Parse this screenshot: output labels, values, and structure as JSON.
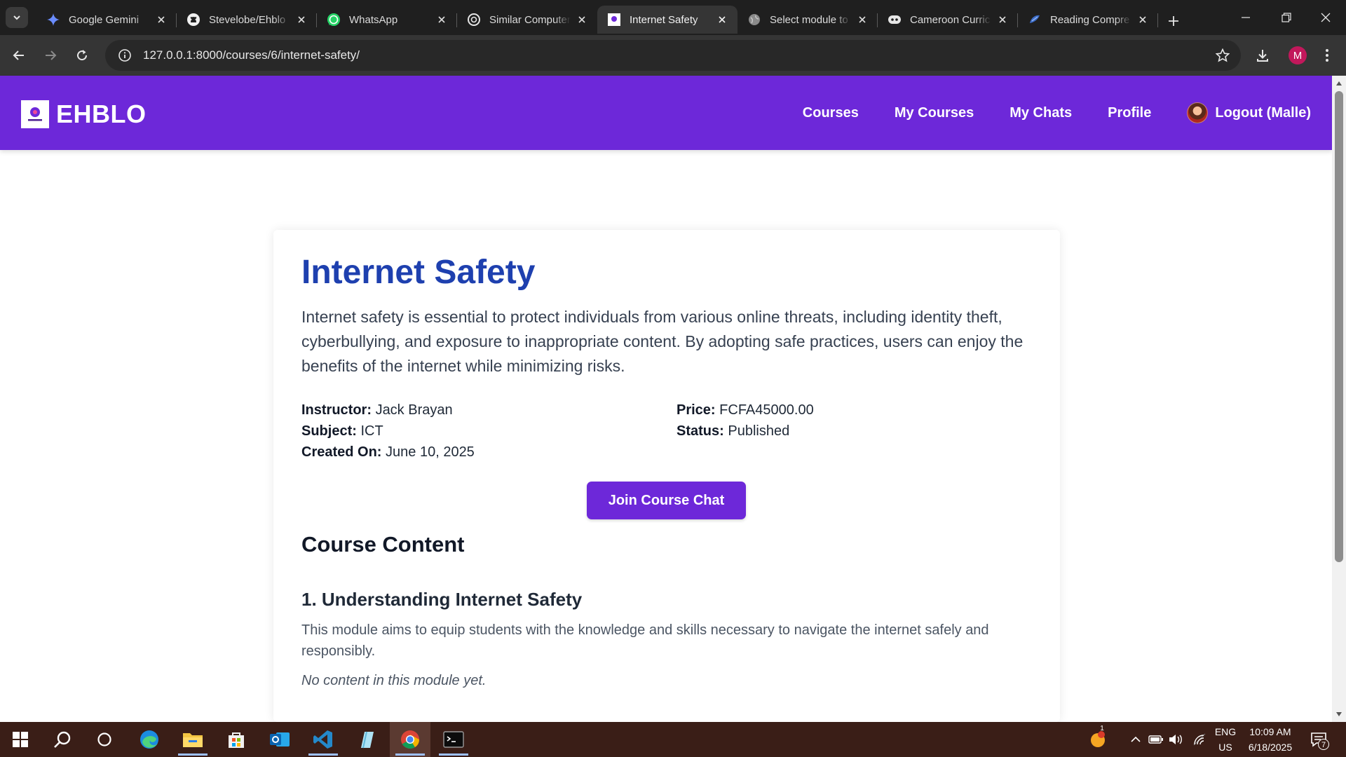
{
  "browser": {
    "tabs": [
      {
        "title": "Google Gemini",
        "icon": "gemini-icon"
      },
      {
        "title": "Stevelobe/Ehblo",
        "icon": "github-icon"
      },
      {
        "title": "WhatsApp",
        "icon": "whatsapp-icon"
      },
      {
        "title": "Similar Computer",
        "icon": "openai-icon"
      },
      {
        "title": "Internet Safety",
        "icon": "ehblo-icon",
        "active": true
      },
      {
        "title": "Select module to",
        "icon": "globe-icon"
      },
      {
        "title": "Cameroon Curric",
        "icon": "discord-icon"
      },
      {
        "title": "Reading Compre",
        "icon": "reading-icon"
      }
    ],
    "url": "127.0.0.1:8000/courses/6/internet-safety/",
    "profile_initial": "M"
  },
  "site": {
    "brand": "EHBLO",
    "brand_logo_text": "EHBLO",
    "nav": {
      "courses": "Courses",
      "my_courses": "My Courses",
      "my_chats": "My Chats",
      "profile": "Profile",
      "logout": "Logout (Malle)"
    },
    "accent_color": "#6d28d9"
  },
  "course": {
    "title": "Internet Safety",
    "description": "Internet safety is essential to protect individuals from various online threats, including identity theft, cyberbullying, and exposure to inappropriate content. By adopting safe practices, users can enjoy the benefits of the internet while minimizing risks.",
    "instructor_label": "Instructor:",
    "instructor": "Jack Brayan",
    "subject_label": "Subject:",
    "subject": "ICT",
    "created_label": "Created On:",
    "created": "June 10, 2025",
    "price_label": "Price:",
    "price": "FCFA45000.00",
    "status_label": "Status:",
    "status": "Published",
    "join_button": "Join Course Chat",
    "content_heading": "Course Content",
    "modules": [
      {
        "title": "1. Understanding Internet Safety",
        "description": "This module aims to equip students with the knowledge and skills necessary to navigate the internet safely and responsibly.",
        "empty_text": "No content in this module yet."
      }
    ]
  },
  "taskbar": {
    "apps": [
      "windows-start-icon",
      "search-icon",
      "task-view-icon",
      "edge-icon",
      "file-explorer-icon",
      "store-icon",
      "outlook-icon",
      "vscode-icon",
      "notepad-icon",
      "chrome-icon",
      "terminal-icon"
    ],
    "weather_badge": "1",
    "language": "ENG",
    "region": "US",
    "time": "10:09 AM",
    "date": "6/18/2025",
    "notification_count": "7"
  }
}
